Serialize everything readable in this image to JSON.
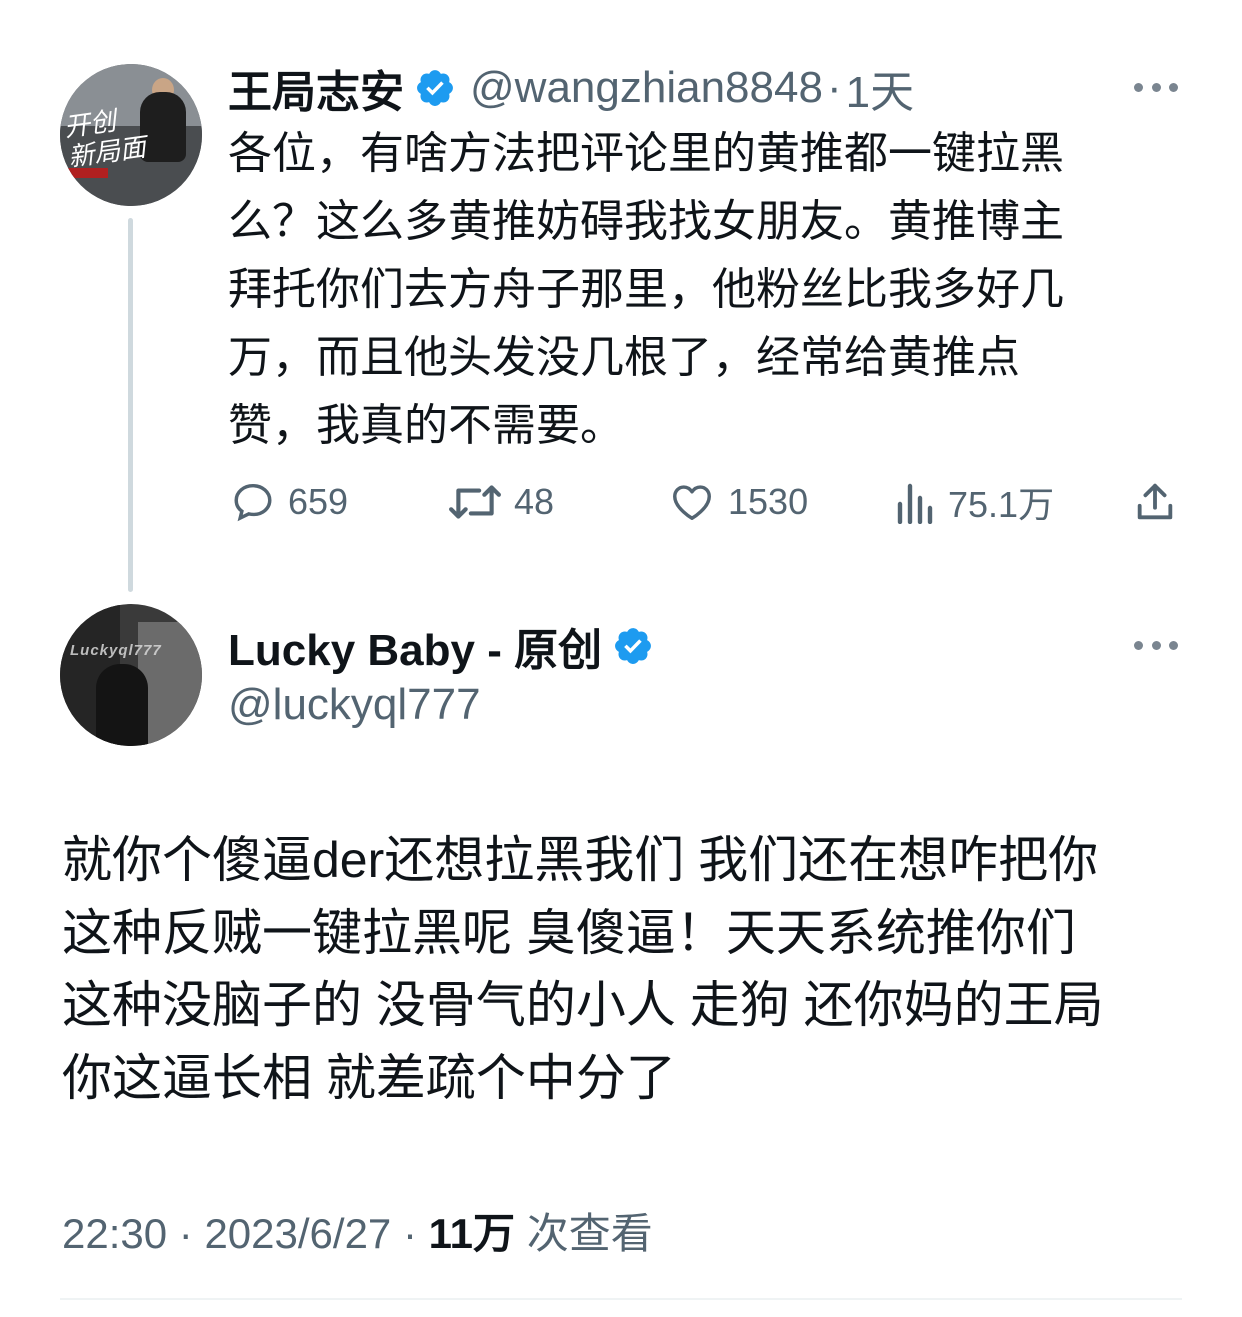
{
  "tweet": {
    "display_name": "王局志安",
    "handle": "@wangzhian8848",
    "separator": "·",
    "time": "1天",
    "text": "各位，有啥方法把评论里的黄推都一键拉黑\n么？这么多黄推妨碍我找女朋友。黄推博主\n拜托你们去方舟子那里，他粉丝比我多好几\n万，而且他头发没几根了，经常给黄推点\n赞，我真的不需要。",
    "avatar_text": "开创\n新局面",
    "actions": {
      "replies": "659",
      "retweets": "48",
      "likes": "1530",
      "views": "75.1万"
    }
  },
  "reply": {
    "display_name": "Lucky Baby - 原创",
    "handle": "@luckyql777",
    "avatar_text": "Luckyql777",
    "text": "就你个傻逼der还想拉黑我们 我们还在想咋把你\n这种反贼一键拉黑呢 臭傻逼！天天系统推你们\n这种没脑子的 没骨气的小人 走狗 还你妈的王局\n你这逼长相 就差疏个中分了",
    "meta": {
      "time": "22:30",
      "sep1": " · ",
      "date": "2023/6/27",
      "sep2": " · ",
      "views_count": "11万",
      "views_label": " 次查看"
    }
  },
  "colors": {
    "text": "#0f1419",
    "secondary": "#536471",
    "verified": "#1d9bf0",
    "thread_line": "#cfd9de"
  },
  "icons": [
    "verified-badge-icon",
    "more-icon",
    "reply-icon",
    "retweet-icon",
    "like-icon",
    "views-icon",
    "share-icon"
  ]
}
